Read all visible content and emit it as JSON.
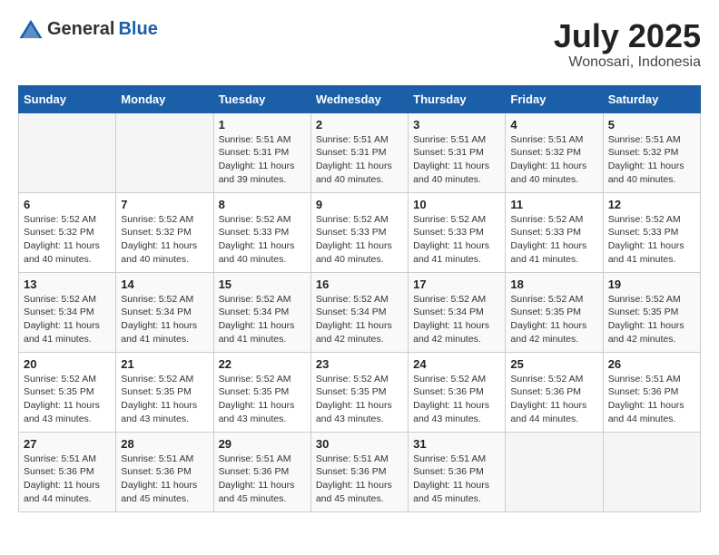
{
  "header": {
    "logo_general": "General",
    "logo_blue": "Blue",
    "month_year": "July 2025",
    "location": "Wonosari, Indonesia"
  },
  "days_of_week": [
    "Sunday",
    "Monday",
    "Tuesday",
    "Wednesday",
    "Thursday",
    "Friday",
    "Saturday"
  ],
  "weeks": [
    [
      {
        "day": "",
        "empty": true
      },
      {
        "day": "",
        "empty": true
      },
      {
        "day": "1",
        "sunrise": "Sunrise: 5:51 AM",
        "sunset": "Sunset: 5:31 PM",
        "daylight": "Daylight: 11 hours and 39 minutes."
      },
      {
        "day": "2",
        "sunrise": "Sunrise: 5:51 AM",
        "sunset": "Sunset: 5:31 PM",
        "daylight": "Daylight: 11 hours and 40 minutes."
      },
      {
        "day": "3",
        "sunrise": "Sunrise: 5:51 AM",
        "sunset": "Sunset: 5:31 PM",
        "daylight": "Daylight: 11 hours and 40 minutes."
      },
      {
        "day": "4",
        "sunrise": "Sunrise: 5:51 AM",
        "sunset": "Sunset: 5:32 PM",
        "daylight": "Daylight: 11 hours and 40 minutes."
      },
      {
        "day": "5",
        "sunrise": "Sunrise: 5:51 AM",
        "sunset": "Sunset: 5:32 PM",
        "daylight": "Daylight: 11 hours and 40 minutes."
      }
    ],
    [
      {
        "day": "6",
        "sunrise": "Sunrise: 5:52 AM",
        "sunset": "Sunset: 5:32 PM",
        "daylight": "Daylight: 11 hours and 40 minutes."
      },
      {
        "day": "7",
        "sunrise": "Sunrise: 5:52 AM",
        "sunset": "Sunset: 5:32 PM",
        "daylight": "Daylight: 11 hours and 40 minutes."
      },
      {
        "day": "8",
        "sunrise": "Sunrise: 5:52 AM",
        "sunset": "Sunset: 5:33 PM",
        "daylight": "Daylight: 11 hours and 40 minutes."
      },
      {
        "day": "9",
        "sunrise": "Sunrise: 5:52 AM",
        "sunset": "Sunset: 5:33 PM",
        "daylight": "Daylight: 11 hours and 40 minutes."
      },
      {
        "day": "10",
        "sunrise": "Sunrise: 5:52 AM",
        "sunset": "Sunset: 5:33 PM",
        "daylight": "Daylight: 11 hours and 41 minutes."
      },
      {
        "day": "11",
        "sunrise": "Sunrise: 5:52 AM",
        "sunset": "Sunset: 5:33 PM",
        "daylight": "Daylight: 11 hours and 41 minutes."
      },
      {
        "day": "12",
        "sunrise": "Sunrise: 5:52 AM",
        "sunset": "Sunset: 5:33 PM",
        "daylight": "Daylight: 11 hours and 41 minutes."
      }
    ],
    [
      {
        "day": "13",
        "sunrise": "Sunrise: 5:52 AM",
        "sunset": "Sunset: 5:34 PM",
        "daylight": "Daylight: 11 hours and 41 minutes."
      },
      {
        "day": "14",
        "sunrise": "Sunrise: 5:52 AM",
        "sunset": "Sunset: 5:34 PM",
        "daylight": "Daylight: 11 hours and 41 minutes."
      },
      {
        "day": "15",
        "sunrise": "Sunrise: 5:52 AM",
        "sunset": "Sunset: 5:34 PM",
        "daylight": "Daylight: 11 hours and 41 minutes."
      },
      {
        "day": "16",
        "sunrise": "Sunrise: 5:52 AM",
        "sunset": "Sunset: 5:34 PM",
        "daylight": "Daylight: 11 hours and 42 minutes."
      },
      {
        "day": "17",
        "sunrise": "Sunrise: 5:52 AM",
        "sunset": "Sunset: 5:34 PM",
        "daylight": "Daylight: 11 hours and 42 minutes."
      },
      {
        "day": "18",
        "sunrise": "Sunrise: 5:52 AM",
        "sunset": "Sunset: 5:35 PM",
        "daylight": "Daylight: 11 hours and 42 minutes."
      },
      {
        "day": "19",
        "sunrise": "Sunrise: 5:52 AM",
        "sunset": "Sunset: 5:35 PM",
        "daylight": "Daylight: 11 hours and 42 minutes."
      }
    ],
    [
      {
        "day": "20",
        "sunrise": "Sunrise: 5:52 AM",
        "sunset": "Sunset: 5:35 PM",
        "daylight": "Daylight: 11 hours and 43 minutes."
      },
      {
        "day": "21",
        "sunrise": "Sunrise: 5:52 AM",
        "sunset": "Sunset: 5:35 PM",
        "daylight": "Daylight: 11 hours and 43 minutes."
      },
      {
        "day": "22",
        "sunrise": "Sunrise: 5:52 AM",
        "sunset": "Sunset: 5:35 PM",
        "daylight": "Daylight: 11 hours and 43 minutes."
      },
      {
        "day": "23",
        "sunrise": "Sunrise: 5:52 AM",
        "sunset": "Sunset: 5:35 PM",
        "daylight": "Daylight: 11 hours and 43 minutes."
      },
      {
        "day": "24",
        "sunrise": "Sunrise: 5:52 AM",
        "sunset": "Sunset: 5:36 PM",
        "daylight": "Daylight: 11 hours and 43 minutes."
      },
      {
        "day": "25",
        "sunrise": "Sunrise: 5:52 AM",
        "sunset": "Sunset: 5:36 PM",
        "daylight": "Daylight: 11 hours and 44 minutes."
      },
      {
        "day": "26",
        "sunrise": "Sunrise: 5:51 AM",
        "sunset": "Sunset: 5:36 PM",
        "daylight": "Daylight: 11 hours and 44 minutes."
      }
    ],
    [
      {
        "day": "27",
        "sunrise": "Sunrise: 5:51 AM",
        "sunset": "Sunset: 5:36 PM",
        "daylight": "Daylight: 11 hours and 44 minutes."
      },
      {
        "day": "28",
        "sunrise": "Sunrise: 5:51 AM",
        "sunset": "Sunset: 5:36 PM",
        "daylight": "Daylight: 11 hours and 45 minutes."
      },
      {
        "day": "29",
        "sunrise": "Sunrise: 5:51 AM",
        "sunset": "Sunset: 5:36 PM",
        "daylight": "Daylight: 11 hours and 45 minutes."
      },
      {
        "day": "30",
        "sunrise": "Sunrise: 5:51 AM",
        "sunset": "Sunset: 5:36 PM",
        "daylight": "Daylight: 11 hours and 45 minutes."
      },
      {
        "day": "31",
        "sunrise": "Sunrise: 5:51 AM",
        "sunset": "Sunset: 5:36 PM",
        "daylight": "Daylight: 11 hours and 45 minutes."
      },
      {
        "day": "",
        "empty": true
      },
      {
        "day": "",
        "empty": true
      }
    ]
  ]
}
